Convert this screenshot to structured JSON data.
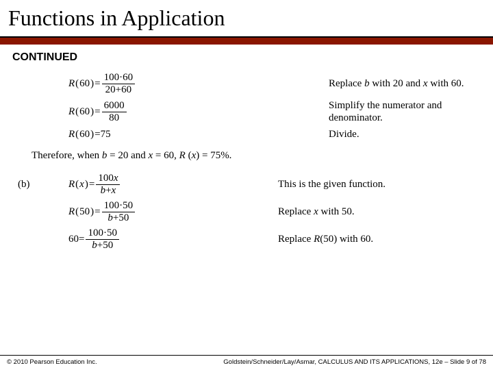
{
  "title": "Functions in Application",
  "continued": "CONTINUED",
  "rows": [
    {
      "lhs": "R(60)",
      "frac_num": "100·60",
      "frac_den": "20+60",
      "explain": "Replace b with 20 and x with 60."
    },
    {
      "lhs": "R(60)",
      "frac_num": "6000",
      "frac_den": "80",
      "explain": "Simplify the numerator and denominator."
    },
    {
      "lhs": "R(60)",
      "rhs_plain": "75",
      "explain": "Divide."
    }
  ],
  "summary": {
    "pre": "Therefore, when ",
    "b": "b",
    "eq1": " = 20 and ",
    "x": "x",
    "eq2": " = 60, ",
    "R": "R",
    "paren": " (",
    "xv": "x",
    "close": ") = 75%."
  },
  "part_b_label": "(b)",
  "rows_b": [
    {
      "lhs_fn": "R",
      "lhs_arg": "x",
      "frac_num": "100x",
      "frac_den": "b+x",
      "explain": "This is the given function."
    },
    {
      "lhs_fn": "R",
      "lhs_arg": "50",
      "frac_num": "100·50",
      "frac_den": "b+50",
      "explain": "Replace x with 50."
    },
    {
      "lhs_plain": "60",
      "frac_num": "100·50",
      "frac_den": "b+50",
      "explain": "Replace R(50) with 60."
    }
  ],
  "footer": {
    "left": "© 2010 Pearson Education Inc.",
    "right": "Goldstein/Schneider/Lay/Asmar, CALCULUS AND ITS APPLICATIONS, 12e – Slide 9 of 78"
  }
}
